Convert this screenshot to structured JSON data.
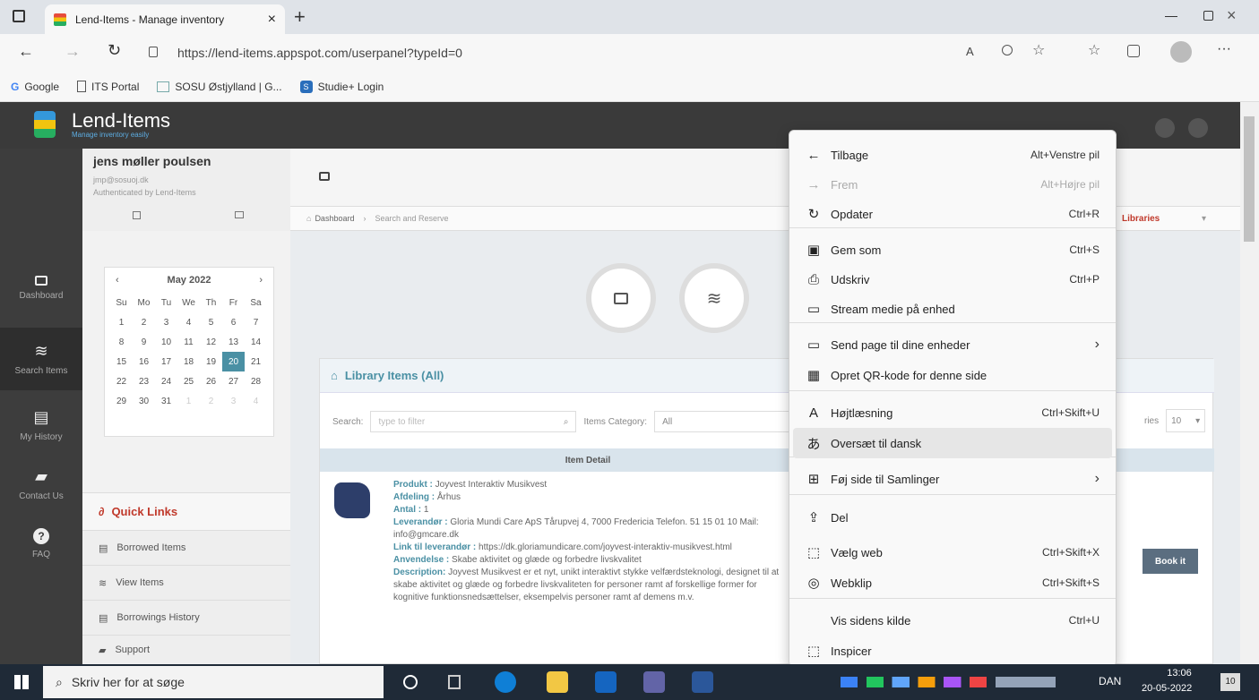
{
  "browser": {
    "tab_title": "Lend-Items - Manage inventory",
    "close_glyph": "×",
    "new_tab_glyph": "+",
    "url": "https://lend-items.appspot.com/userpanel?typeId=0",
    "bookmarks": [
      "Google",
      "ITS Portal",
      "SOSU Østjylland | G...",
      "Studie+ Login"
    ]
  },
  "app": {
    "logo_title": "Lend-Items",
    "logo_subtitle": "Manage inventory easily",
    "user_name": "jens møller poulsen",
    "user_email": "jmp@sosuoj.dk",
    "user_auth": "Authenticated by Lend-Items",
    "nav": [
      {
        "label": "Dashboard",
        "icon": "monitor-icon"
      },
      {
        "label": "Search Items",
        "icon": "layers-icon"
      },
      {
        "label": "My History",
        "icon": "history-icon"
      },
      {
        "label": "Contact Us",
        "icon": "chat-icon"
      },
      {
        "label": "FAQ",
        "icon": "question-icon"
      }
    ],
    "breadcrumb": {
      "home": "Dashboard",
      "current": "Search and Reserve"
    },
    "libraries_label": "Libraries",
    "calendar": {
      "month": "May 2022",
      "weekdays": [
        "Su",
        "Mo",
        "Tu",
        "We",
        "Th",
        "Fr",
        "Sa"
      ],
      "weeks": [
        [
          "1",
          "2",
          "3",
          "4",
          "5",
          "6",
          "7"
        ],
        [
          "8",
          "9",
          "10",
          "11",
          "12",
          "13",
          "14"
        ],
        [
          "15",
          "16",
          "17",
          "18",
          "19",
          "20",
          "21"
        ],
        [
          "22",
          "23",
          "24",
          "25",
          "26",
          "27",
          "28"
        ],
        [
          "29",
          "30",
          "31",
          "1",
          "2",
          "3",
          "4"
        ]
      ],
      "today": "20"
    },
    "quick_links": {
      "title": "Quick Links",
      "items": [
        "Borrowed Items",
        "View Items",
        "Borrowings History",
        "Support"
      ]
    },
    "library": {
      "title": "Library Items (All)",
      "search_label": "Search:",
      "search_placeholder": "type to filter",
      "category_label": "Items Category:",
      "category_value": "All",
      "entries_label": "ries",
      "entries_value": "10",
      "column": "Item Detail",
      "book_button": "Book it",
      "item": {
        "produkt_label": "Produkt :",
        "produkt": "Joyvest Interaktiv Musikvest",
        "afdeling_label": "Afdeling :",
        "afdeling": "Århus",
        "antal_label": "Antal :",
        "antal": "1",
        "leverandor_label": "Leverandør :",
        "leverandor": "Gloria Mundi Care ApS Tårupvej 4, 7000 Fredericia Telefon. 51 15 01 10 Mail: info@gmcare.dk",
        "link_label": "Link til leverandør :",
        "link": "https://dk.gloriamundicare.com/joyvest-interaktiv-musikvest.html",
        "anvendelse_label": "Anvendelse :",
        "anvendelse": "Skabe aktivitet og glæde og forbedre livskvalitet",
        "description_label": "Description:",
        "description": "Joyvest Musikvest er et nyt, unikt interaktivt stykke velfærdsteknologi, designet til at skabe aktivitet og glæde og forbedre livskvaliteten for personer ramt af forskellige former for kognitive funktionsnedsættelser, eksempelvis personer ramt af demens m.v."
      }
    }
  },
  "context_menu": [
    {
      "label": "Tilbage",
      "shortcut": "Alt+Venstre pil",
      "icon": "arrow-left-icon",
      "glyph": "←",
      "disabled": false
    },
    {
      "label": "Frem",
      "shortcut": "Alt+Højre pil",
      "icon": "arrow-right-icon",
      "glyph": "→",
      "disabled": true
    },
    {
      "label": "Opdater",
      "shortcut": "Ctrl+R",
      "icon": "refresh-icon",
      "glyph": "↻",
      "disabled": false
    },
    {
      "label": "Gem som",
      "shortcut": "Ctrl+S",
      "icon": "save-icon",
      "glyph": "▣",
      "disabled": false
    },
    {
      "label": "Udskriv",
      "shortcut": "Ctrl+P",
      "icon": "print-icon",
      "glyph": "⎙",
      "disabled": false
    },
    {
      "label": "Stream medie på enhed",
      "shortcut": "",
      "icon": "cast-icon",
      "glyph": "▭",
      "disabled": false
    },
    {
      "label": "Send page til dine enheder",
      "shortcut": "",
      "submenu": true,
      "icon": "devices-icon",
      "glyph": "▭",
      "disabled": false
    },
    {
      "label": "Opret QR-kode for denne side",
      "shortcut": "",
      "icon": "qr-code-icon",
      "glyph": "▦",
      "disabled": false
    },
    {
      "label": "Højtlæsning",
      "shortcut": "Ctrl+Skift+U",
      "icon": "read-aloud-icon",
      "glyph": "A",
      "disabled": false
    },
    {
      "label": "Oversæt til dansk",
      "shortcut": "",
      "icon": "translate-icon",
      "glyph": "あ",
      "disabled": false,
      "highlighted": true
    },
    {
      "label": "Føj side til Samlinger",
      "shortcut": "",
      "submenu": true,
      "icon": "collections-icon",
      "glyph": "⊞",
      "disabled": false
    },
    {
      "label": "Del",
      "shortcut": "",
      "icon": "share-icon",
      "glyph": "⇪",
      "disabled": false
    },
    {
      "label": "Vælg web",
      "shortcut": "Ctrl+Skift+X",
      "icon": "web-select-icon",
      "glyph": "⬚",
      "disabled": false
    },
    {
      "label": "Webklip",
      "shortcut": "Ctrl+Skift+S",
      "icon": "web-capture-icon",
      "glyph": "◎",
      "disabled": false
    },
    {
      "label": "Vis sidens kilde",
      "shortcut": "Ctrl+U",
      "icon": "",
      "glyph": "",
      "disabled": false
    },
    {
      "label": "Inspicer",
      "shortcut": "",
      "icon": "inspect-icon",
      "glyph": "⬚",
      "disabled": false
    }
  ],
  "submenu_glyph": "›",
  "taskbar": {
    "search_placeholder": "Skriv her for at søge",
    "language": "DAN",
    "time": "13:06",
    "date": "20-05-2022",
    "notifications": "10"
  },
  "colors": {
    "accent": "#4a90a4",
    "quick_links_red": "#c0392b",
    "book_button": "#5b6e80",
    "header_dark": "#3a3a3a"
  }
}
